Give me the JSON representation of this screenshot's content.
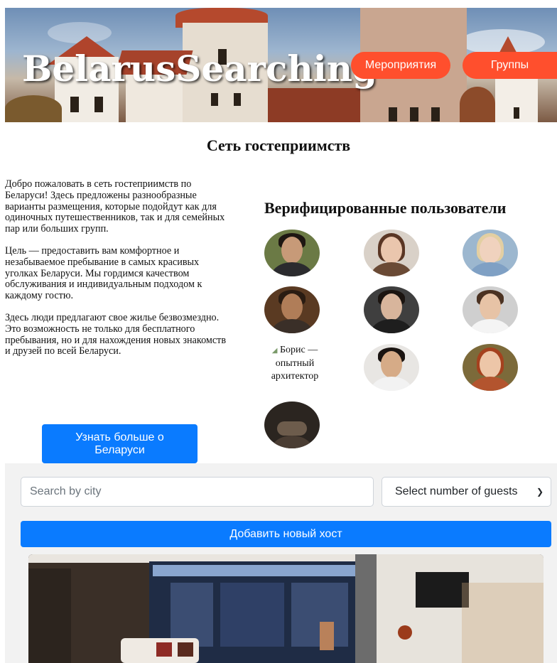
{
  "header": {
    "brand": "BelarusSearching",
    "nav": [
      {
        "label": "Мероприятия"
      },
      {
        "label": "Группы"
      }
    ],
    "accent_color": "#ff4f2d"
  },
  "main": {
    "title": "Сеть гостеприимств",
    "intro_paragraphs": [
      "Добро пожаловать в сеть гостеприимств по Беларуси! Здесь предложены разнообразные варианты размещения, которые подойдут как для одиночных путешественников, так и для семейных пар или больших групп.",
      "Цель — предоставить вам комфортное и незабываемое пребывание в самых красивых уголках Беларуси. Мы гордимся качеством обслуживания и индивидуальным подходом к каждому гостю.",
      "Здесь люди предлагают свое жилье безвозмездно. Это возможность не только для бесплатного пребывания, но и для нахождения новых знакомств и друзей по всей Беларуси."
    ],
    "learn_more_label": "Узнать больше о Беларуси"
  },
  "verified": {
    "title": "Верифицированные пользователи",
    "broken_image_alt": "Борис — опытный архитектор"
  },
  "search": {
    "city_placeholder": "Search by city",
    "guests_selected": "Select number of guests",
    "add_host_label": "Добавить новый хост",
    "primary_color": "#0a7bff"
  }
}
